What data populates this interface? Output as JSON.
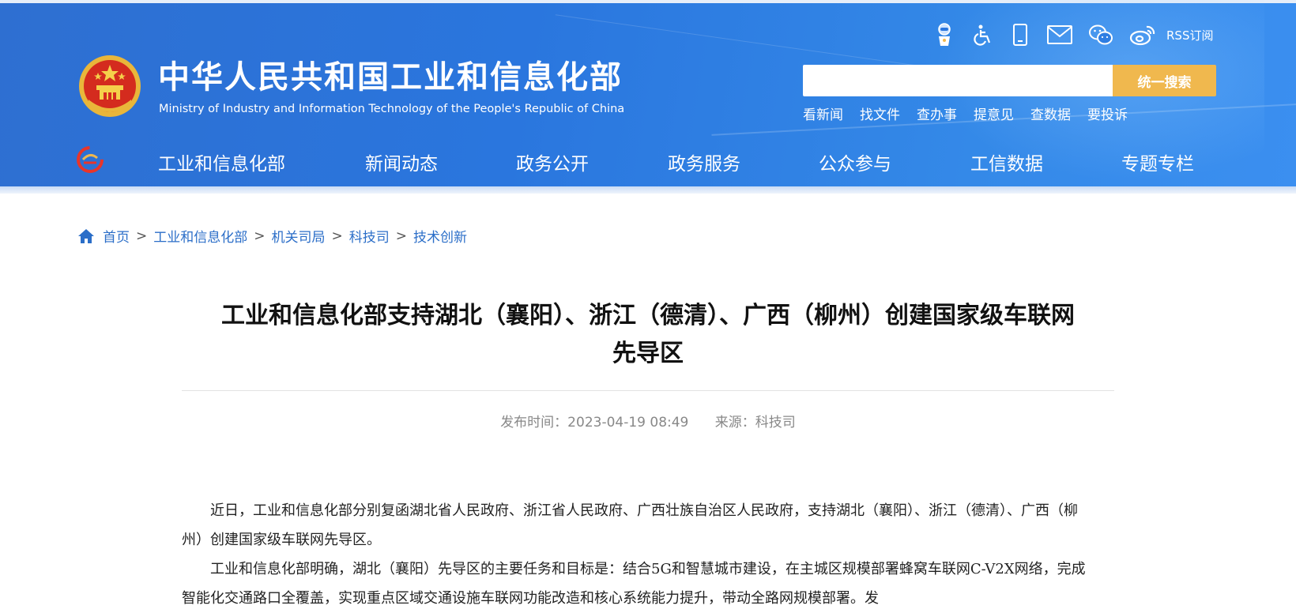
{
  "site": {
    "title": "中华人民共和国工业和信息化部",
    "subtitle": "Ministry of Industry and Information Technology of the People's Republic of China"
  },
  "toolbar": {
    "icons": [
      "robot-assistant-icon",
      "accessibility-icon",
      "mobile-icon",
      "mail-icon",
      "wechat-icon",
      "weibo-icon"
    ],
    "rss_label": "RSS订阅"
  },
  "search": {
    "placeholder": "",
    "button_label": "统一搜索"
  },
  "quick_links": [
    "看新闻",
    "找文件",
    "查办事",
    "提意见",
    "查数据",
    "要投诉"
  ],
  "nav": {
    "items": [
      "工业和信息化部",
      "新闻动态",
      "政务公开",
      "政务服务",
      "公众参与",
      "工信数据",
      "专题专栏"
    ]
  },
  "breadcrumb": {
    "items": [
      "首页",
      "工业和信息化部",
      "机关司局",
      "科技司",
      "技术创新"
    ],
    "separator": ">"
  },
  "article": {
    "title_line1": "工业和信息化部支持湖北（襄阳）、浙江（德清）、广西（柳州）创建国家级车联网",
    "title_line2": "先导区",
    "publish_label": "发布时间：2023-04-19 08:49",
    "source_label": "来源：科技司",
    "paragraphs": [
      "近日，工业和信息化部分别复函湖北省人民政府、浙江省人民政府、广西壮族自治区人民政府，支持湖北（襄阳）、浙江（德清）、广西（柳州）创建国家级车联网先导区。",
      "工业和信息化部明确，湖北（襄阳）先导区的主要任务和目标是：结合5G和智慧城市建设，在主城区规模部署蜂窝车联网C-V2X网络，完成智能化交通路口全覆盖，实现重点区域交通设施车联网功能改造和核心系统能力提升，带动全路网规模部署。发"
    ]
  },
  "colors": {
    "header_blue": "#2a76de",
    "search_button": "#f0b84e",
    "link_blue": "#2b6ec8"
  }
}
